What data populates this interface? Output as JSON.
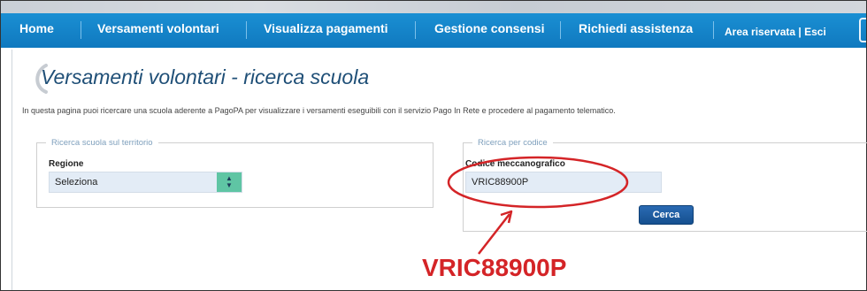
{
  "navbar": {
    "items": [
      {
        "label": "Home"
      },
      {
        "label": "Versamenti volontari"
      },
      {
        "label": "Visualizza pagamenti"
      },
      {
        "label": "Gestione consensi"
      },
      {
        "label": "Richiedi assistenza"
      }
    ],
    "reserved_area": "Area riservata",
    "separator": "|",
    "logout": "Esci"
  },
  "page": {
    "title": "Versamenti volontari - ricerca scuola",
    "intro": "In questa pagina puoi ricercare una scuola aderente a PagoPA per visualizzare i versamenti eseguibili con il servizio Pago In Rete e procedere al pagamento telematico."
  },
  "territory_search": {
    "legend": "Ricerca scuola sul territorio",
    "region_label": "Regione",
    "region_value": "Seleziona"
  },
  "code_search": {
    "legend": "Ricerca per codice",
    "code_label": "Codice meccanografico",
    "code_value": "VRIC88900P",
    "search_button": "Cerca"
  },
  "annotation": {
    "text": "VRIC88900P",
    "color": "#d42427"
  },
  "colors": {
    "nav_blue": "#1483c9",
    "title_blue": "#1f4f77",
    "button_blue": "#1f5ea3",
    "select_green": "#5fc5a4"
  }
}
